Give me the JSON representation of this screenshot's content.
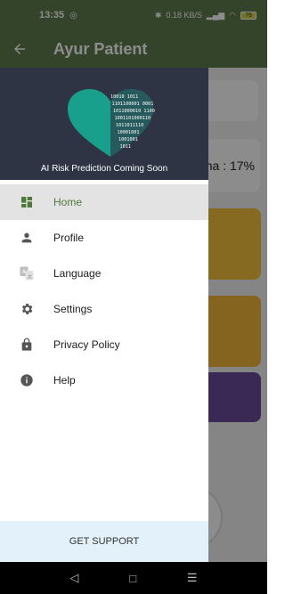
{
  "status_bar": {
    "time": "13:35",
    "speed": "0.18 KB/S",
    "battery": "76"
  },
  "app_bar": {
    "title": "Ayur Patient"
  },
  "background": {
    "card_text": "na : 17%"
  },
  "drawer": {
    "header": {
      "caption": "AI Risk Prediction Coming Soon",
      "binary_lines": [
        "10010 1011",
        "1101100001 0001",
        "1011000010 1100",
        "1001101000110",
        "1011011110",
        "10001001",
        "1001001",
        "1011"
      ]
    },
    "items": [
      {
        "label": "Home",
        "icon": "dashboard-icon",
        "active": true
      },
      {
        "label": "Profile",
        "icon": "person-icon",
        "active": false
      },
      {
        "label": "Language",
        "icon": "translate-icon",
        "active": false
      },
      {
        "label": "Settings",
        "icon": "gear-icon",
        "active": false
      },
      {
        "label": "Privacy Policy",
        "icon": "lock-icon",
        "active": false
      },
      {
        "label": "Help",
        "icon": "info-icon",
        "active": false
      }
    ],
    "support_label": "GET SUPPORT"
  },
  "colors": {
    "primary": "#5f7c4d",
    "header_bg": "#2e3444",
    "heart": "#19a08c",
    "active_text": "#4e7a3a",
    "support_bg": "#e3f1fa"
  }
}
